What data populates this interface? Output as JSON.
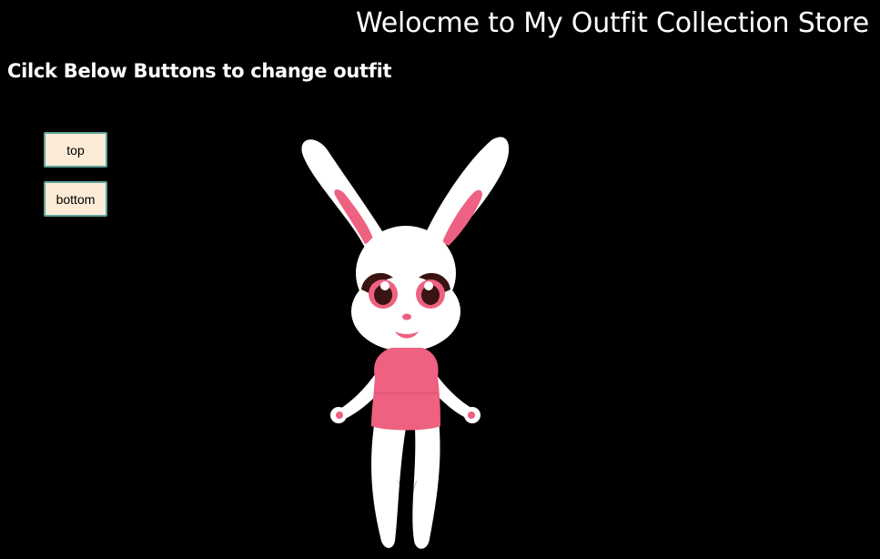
{
  "header": {
    "title": "Welocme to My Outfit Collection Store",
    "subtitle": "Cilck Below Buttons to change outfit"
  },
  "controls": {
    "top_label": "top",
    "bottom_label": "bottom"
  },
  "character": {
    "name": "bunny",
    "outfit": "pink-dress",
    "colors": {
      "fur": "#ffffff",
      "accent": "#ee6181",
      "eye_dark": "#3a1412",
      "background": "#000000",
      "button_bg": "#fcebd6",
      "button_border": "#5fa39b"
    }
  }
}
